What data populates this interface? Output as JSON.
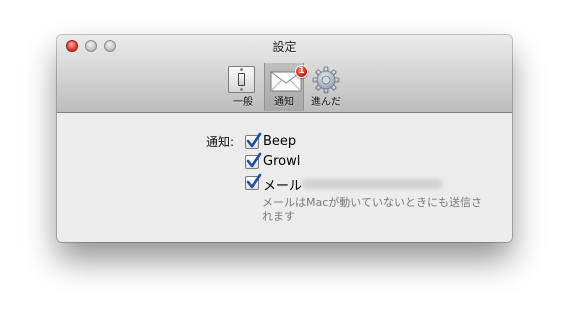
{
  "window": {
    "title": "設定"
  },
  "toolbar": {
    "items": [
      {
        "label": "一般",
        "icon": "switch-icon",
        "selected": false
      },
      {
        "label": "通知",
        "icon": "mail-icon",
        "selected": true,
        "badge": "1"
      },
      {
        "label": "進んだ",
        "icon": "gear-icon",
        "selected": false
      }
    ]
  },
  "notifications": {
    "label": "通知:",
    "options": [
      {
        "label": "Beep",
        "checked": true
      },
      {
        "label": "Growl",
        "checked": true
      },
      {
        "label": "メール",
        "checked": true
      }
    ],
    "mail_note": "メールはMacが動いていないときにも送信されます"
  },
  "colors": {
    "close_button": "#f0504a",
    "badge": "#d4150a",
    "checkmark": "#1f4fa8"
  }
}
